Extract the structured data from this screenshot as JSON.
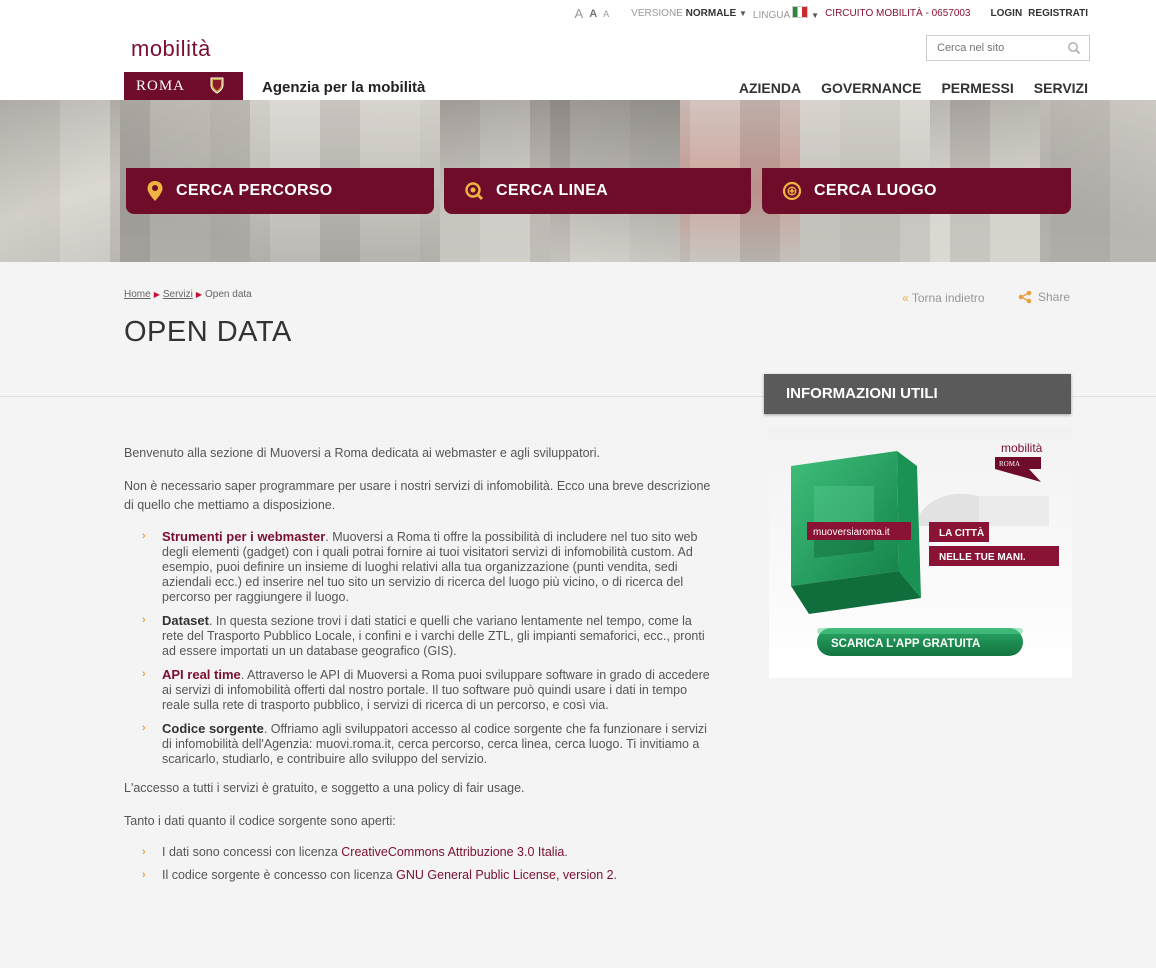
{
  "utility": {
    "font_sizes": [
      "A",
      "A",
      "A"
    ],
    "versione_label": "VERSIONE",
    "versione_value": "NORMALE",
    "lingua_label": "LINGUA",
    "circuito": "CIRCUITO MOBILITÀ - 0657003",
    "login": "LOGIN",
    "registrati": "REGISTRATI"
  },
  "search": {
    "placeholder": "Cerca nel sito",
    "icon": "search-icon"
  },
  "logo": {
    "word": "mobilità",
    "roma": "ROMA",
    "agency": "Agenzia per la mobilità"
  },
  "nav": [
    "AZIENDA",
    "GOVERNANCE",
    "PERMESSI",
    "SERVIZI"
  ],
  "banner_buttons": [
    {
      "label": "CERCA PERCORSO",
      "icon": "map-pin-icon"
    },
    {
      "label": "CERCA LINEA",
      "icon": "search-pin-icon"
    },
    {
      "label": "CERCA LUOGO",
      "icon": "plus-circle-icon"
    }
  ],
  "breadcrumb": [
    "Home",
    "Servizi",
    "Open data"
  ],
  "back_label": "Torna indietro",
  "share_label": "Share",
  "page_title": "OPEN DATA",
  "sidebar": {
    "heading": "INFORMAZIONI UTILI",
    "ad": {
      "logo_word": "mobilità",
      "logo_roma": "ROMA",
      "site": "muoversiaroma.it",
      "tag1": "LA CITTÀ",
      "tag2": "NELLE TUE MANI.",
      "cta": "SCARICA L'APP GRATUITA"
    }
  },
  "content": {
    "intro": "Benvenuto alla sezione di Muoversi a Roma dedicata ai webmaster e agli sviluppatori.",
    "intro2": "Non è necessario saper programmare per usare i nostri servizi di infomobilità. Ecco una breve descrizione di quello che mettiamo a disposizione.",
    "items": [
      {
        "title": "Strumenti per i webmaster",
        "text": ". Muoversi a Roma ti offre la possibilità di includere nel tuo sito web degli elementi (gadget) con i quali potrai fornire ai tuoi visitatori servizi di infomobilità custom. Ad esempio, puoi definire un insieme di luoghi relativi alla tua organizzazione (punti vendita, sedi aziendali ecc.) ed inserire nel tuo sito un servizio di ricerca del luogo più vicino, o di ricerca del percorso per raggiungere il luogo."
      },
      {
        "title": "Dataset",
        "text": ". In questa sezione trovi i dati statici e quelli che variano lentamente nel tempo, come la rete del Trasporto Pubblico Locale, i confini e i varchi delle ZTL, gli impianti semaforici, ecc., pronti ad essere importati un un database geografico (GIS)."
      },
      {
        "title": "API real time",
        "text": ". Attraverso le API di Muoversi a Roma puoi sviluppare software in grado di accedere ai servizi di infomobilità offerti dal nostro portale. Il tuo software può quindi usare i dati in tempo reale sulla rete di trasporto pubblico, i servizi di ricerca di un percorso, e così via."
      },
      {
        "title": "Codice sorgente",
        "text": ". Offriamo agli sviluppatori accesso al codice sorgente che fa funzionare i servizi di infomobilità dell'Agenzia: muovi.roma.it, cerca percorso, cerca linea, cerca luogo. Ti invitiamo a scaricarlo, studiarlo, e contribuire allo sviluppo del servizio."
      }
    ],
    "free": "L'accesso a tutti i servizi è gratuito, e soggetto a una policy di fair usage.",
    "open": "Tanto i dati quanto il codice sorgente sono aperti:",
    "licenses": [
      {
        "prefix": "I dati sono concessi con licenza ",
        "link": "CreativeCommons Attribuzione 3.0 Italia",
        "suffix": "."
      },
      {
        "prefix": "Il codice sorgente è concesso con licenza ",
        "link": "GNU General Public License, version 2",
        "suffix": "."
      }
    ]
  },
  "colors": {
    "brand": "#6e0c29",
    "accent_orange": "#e8a040",
    "link": "#7a0f2f",
    "sidebar_head": "#5a5a5a"
  }
}
